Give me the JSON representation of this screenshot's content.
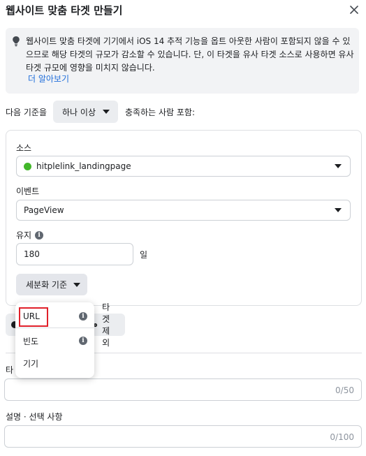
{
  "dialog": {
    "title": "웹사이트 맞춤 타겟 만들기",
    "close_icon": "close-icon"
  },
  "info_banner": {
    "icon": "lightbulb-icon",
    "text": "웹사이트 맞춤 타겟에 기기에서 iOS 14 추적 기능을 옵트 아웃한 사람이 포함되지 않을 수 있으므로 해당 타겟의 규모가 감소할 수 있습니다. 단, 이 타겟을 유사 타겟 소스로 사용하면 유사 타겟 규모에 영향을 미치지 않습니다.",
    "learn_more": "더 알아보기"
  },
  "criteria": {
    "prefix": "다음 기준을",
    "match_value": "하나 이상",
    "suffix": "충족하는 사람 포함:"
  },
  "rule": {
    "source_label": "소스",
    "source_value": "hitplelink_landingpage",
    "source_status_color": "#42b72a",
    "event_label": "이벤트",
    "event_value": "PageView",
    "retention_label": "유지",
    "retention_value": "180",
    "retention_unit": "일",
    "refine_label": "세분화 기준"
  },
  "refine_menu": {
    "items": [
      {
        "label": "URL",
        "info": true,
        "highlighted": true
      },
      {
        "label": "빈도",
        "info": true
      },
      {
        "label": "기기",
        "info": false
      }
    ]
  },
  "actions": {
    "exclude_label": "타겟 제외"
  },
  "name_field": {
    "label_visible": "타",
    "counter": "0/50"
  },
  "description_field": {
    "label": "설명 · 선택 사항",
    "counter": "0/100"
  },
  "colors": {
    "link": "#216fdb",
    "highlight_border": "#e0202a",
    "banner_bg": "#f2f3f5"
  }
}
